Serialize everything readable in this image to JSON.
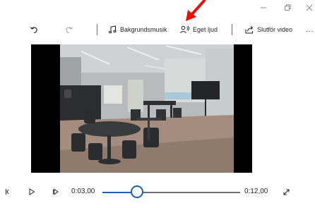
{
  "window": {
    "controls": [
      "minimize-icon",
      "restore-icon",
      "close-icon"
    ]
  },
  "toolbar": {
    "undo_icon": "undo-icon",
    "redo_icon": "redo-icon",
    "background_music_label": "Bakgrundsmusik",
    "custom_audio_label": "Eget ljud",
    "finish_video_label": "Slutför video",
    "more_label": "..."
  },
  "player": {
    "current_time": "0:03,00",
    "total_time": "0:12,00",
    "progress": 0.25
  },
  "colors": {
    "accent": "#1a5fb4",
    "annotation": "#e3120b",
    "track": "#6f6f6f"
  }
}
